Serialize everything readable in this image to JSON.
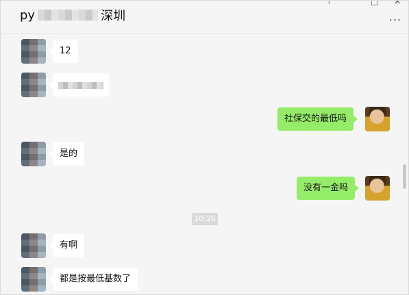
{
  "title": {
    "prefix": "py",
    "suffix": "深圳"
  },
  "window_controls": {
    "pin": "⊤",
    "maximize": "□",
    "close": "✕"
  },
  "menu": {
    "more": "..."
  },
  "messages": [
    {
      "side": "left",
      "text": "12"
    },
    {
      "side": "left",
      "text": ""
    },
    {
      "side": "right",
      "text": "社保交的最低吗"
    },
    {
      "side": "left",
      "text": "是的"
    },
    {
      "side": "right",
      "text": "没有一金吗"
    },
    {
      "type": "timestamp",
      "text": "10:26"
    },
    {
      "side": "left",
      "text": "有啊"
    },
    {
      "side": "left",
      "text": "都是按最低基数了"
    }
  ],
  "colors": {
    "background": "#f5f5f5",
    "outgoing_bubble": "#95ec69",
    "incoming_bubble": "#ffffff"
  }
}
